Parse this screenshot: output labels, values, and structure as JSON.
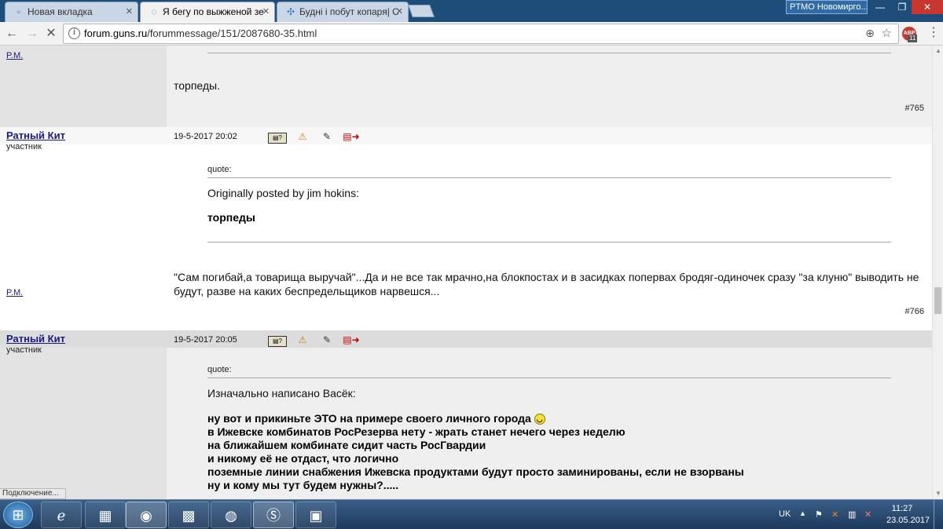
{
  "browser": {
    "tabs": [
      {
        "label": "Новая вкладка",
        "icon": "page-icon"
      },
      {
        "label": "Я бегу по выжженой зе",
        "icon": "loading-spinner-icon"
      },
      {
        "label": "Будні і побут копаря| С",
        "icon": "puzzle-icon"
      }
    ],
    "window_title": "PTMO Новомирго...",
    "url_host": "forum.guns.ru",
    "url_path": "/forummessage/151/2087680-35.html",
    "abp_badge": "11",
    "status_text": "Подключение..."
  },
  "posts": [
    {
      "rm": "P.M.",
      "body": "торпеды.",
      "number": "#765"
    },
    {
      "author": "Ратный Кит",
      "role": "участник",
      "date": "19-5-2017 20:02",
      "quote_label": "quote:",
      "quote_head": "Originally posted by jim hokins:",
      "quote_lines": [
        "торпеды"
      ],
      "body": "\"Сам погибай,а товарища выручай\"...Да и не все так мрачно,на блокпостах и в засидках попервах бродяг-одиночек сразу \"за клуню\" выводить не будут, разве на каких беспредельщиков нарвешся...",
      "rm": "P.M.",
      "number": "#766"
    },
    {
      "author": "Ратный Кит",
      "role": "участник",
      "date": "19-5-2017 20:05",
      "quote_label": "quote:",
      "quote_head": "Изначально написано Васёк:",
      "quote_lines": [
        "ну вот и прикиньте ЭТО на примере своего личного города",
        "в Ижевске комбинатов РосРезерва нету - жрать станет нечего через неделю",
        "на ближайшем комбинате сидит часть РосГвардии",
        "и никому её не отдаст, что логично",
        "поземные линии снабжения Ижевска продуктами будут просто заминированы, если не взорваны",
        "ну и кому мы тут будем нужны?....."
      ]
    }
  ],
  "taskbar": {
    "tray_lang": "UK",
    "time": "11:27",
    "date": "23.05.2017"
  }
}
